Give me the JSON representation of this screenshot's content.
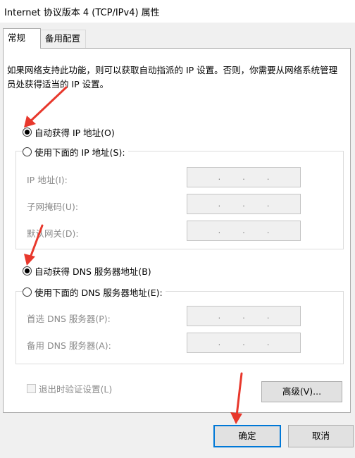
{
  "window": {
    "title": "Internet 协议版本 4 (TCP/IPv4) 属性"
  },
  "tabs": [
    {
      "label": "常规",
      "active": true
    },
    {
      "label": "备用配置",
      "active": false
    }
  ],
  "description": "如果网络支持此功能，则可以获取自动指派的 IP 设置。否则，你需要从网络系统管理员处获得适当的 IP 设置。",
  "ip_section": {
    "auto_label": "自动获得 IP 地址(O)",
    "auto_selected": true,
    "manual_label": "使用下面的 IP 地址(S):",
    "manual_selected": false,
    "fields": [
      {
        "label": "IP 地址(I):",
        "value": ".   .   ."
      },
      {
        "label": "子网掩码(U):",
        "value": ".   .   ."
      },
      {
        "label": "默认网关(D):",
        "value": ".   .   ."
      }
    ]
  },
  "dns_section": {
    "auto_label": "自动获得 DNS 服务器地址(B)",
    "auto_selected": true,
    "manual_label": "使用下面的 DNS 服务器地址(E):",
    "manual_selected": false,
    "fields": [
      {
        "label": "首选 DNS 服务器(P):",
        "value": ".   .   ."
      },
      {
        "label": "备用 DNS 服务器(A):",
        "value": ".   .   ."
      }
    ]
  },
  "validate_checkbox": {
    "label": "退出时验证设置(L)",
    "checked": false
  },
  "buttons": {
    "advanced": "高级(V)...",
    "ok": "确定",
    "cancel": "取消"
  },
  "colors": {
    "annotation_arrow": "#e8382c",
    "focus_border": "#0078d7"
  }
}
